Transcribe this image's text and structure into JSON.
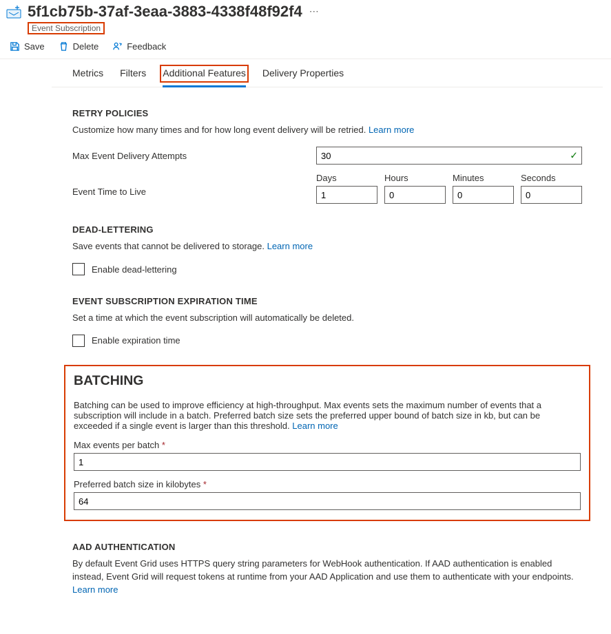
{
  "header": {
    "title": "5f1cb75b-37af-3eaa-3883-4338f48f92f4",
    "subtitle": "Event Subscription"
  },
  "commands": {
    "save": "Save",
    "delete": "Delete",
    "feedback": "Feedback"
  },
  "tabs": {
    "metrics": "Metrics",
    "filters": "Filters",
    "additional": "Additional Features",
    "delivery": "Delivery Properties"
  },
  "retry": {
    "heading": "RETRY POLICIES",
    "desc": "Customize how many times and for how long event delivery will be retried.",
    "learn": "Learn more",
    "max_label": "Max Event Delivery Attempts",
    "max_value": "30",
    "ttl_label": "Event Time to Live",
    "ttl_headers": {
      "days": "Days",
      "hours": "Hours",
      "minutes": "Minutes",
      "seconds": "Seconds"
    },
    "ttl_values": {
      "days": "1",
      "hours": "0",
      "minutes": "0",
      "seconds": "0"
    }
  },
  "deadletter": {
    "heading": "DEAD-LETTERING",
    "desc": "Save events that cannot be delivered to storage.",
    "learn": "Learn more",
    "enable": "Enable dead-lettering"
  },
  "expiration": {
    "heading": "EVENT SUBSCRIPTION EXPIRATION TIME",
    "desc": "Set a time at which the event subscription will automatically be deleted.",
    "enable": "Enable expiration time"
  },
  "batching": {
    "heading": "BATCHING",
    "desc": "Batching can be used to improve efficiency at high-throughput. Max events sets the maximum number of events that a subscription will include in a batch. Preferred batch size sets the preferred upper bound of batch size in kb, but can be exceeded if a single event is larger than this threshold.",
    "learn": "Learn more",
    "max_events_label": "Max events per batch",
    "max_events_value": "1",
    "pref_size_label": "Preferred batch size in kilobytes",
    "pref_size_value": "64"
  },
  "aad": {
    "heading": "AAD AUTHENTICATION",
    "desc": "By default Event Grid uses HTTPS query string parameters for WebHook authentication. If AAD authentication is enabled instead, Event Grid will request tokens at runtime from your AAD Application and use them to authenticate with your endpoints.",
    "learn": "Learn more"
  }
}
